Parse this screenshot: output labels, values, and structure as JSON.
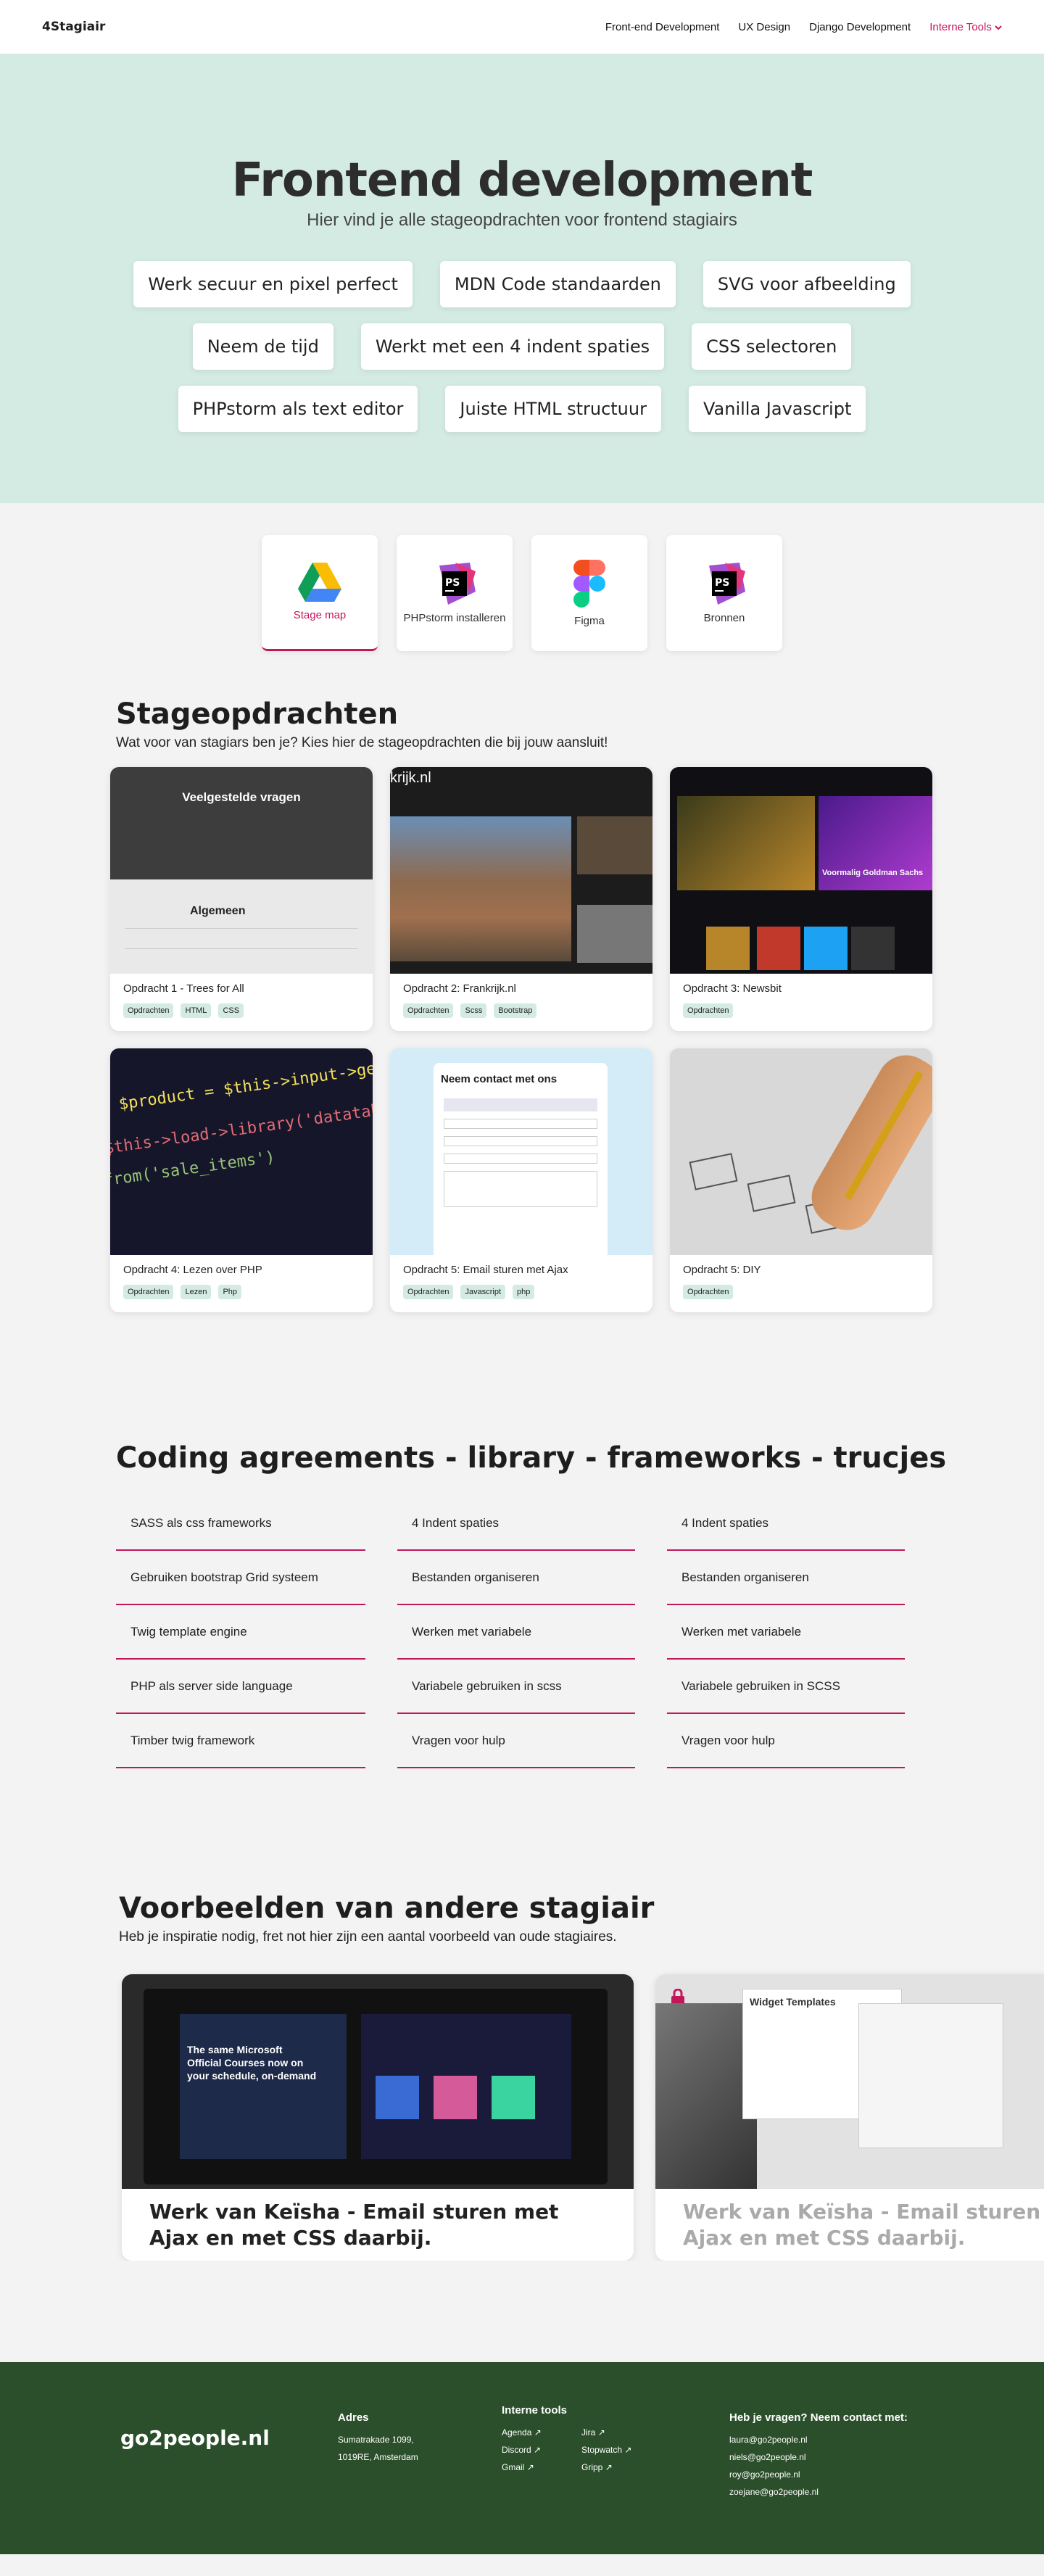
{
  "nav": {
    "logo": "4Stagiair",
    "links": [
      "Front-end Development",
      "UX Design",
      "Django Development"
    ],
    "dropdown": "Interne Tools"
  },
  "hero": {
    "title": "Frontend development",
    "subtitle": "Hier vind je alle stageopdrachten voor frontend stagiairs",
    "pills": [
      [
        "Werk secuur en pixel perfect",
        "MDN Code standaarden",
        "SVG voor afbeelding"
      ],
      [
        "Neem de tijd",
        "Werkt met een 4 indent spaties",
        "CSS selectoren"
      ],
      [
        "PHPstorm als text editor",
        "Juiste HTML structuur",
        "Vanilla Javascript"
      ]
    ]
  },
  "tools": [
    {
      "label": "Stage map",
      "icon": "google-drive-icon"
    },
    {
      "label": "PHPstorm installeren",
      "icon": "phpstorm-icon"
    },
    {
      "label": "Figma",
      "icon": "figma-icon"
    },
    {
      "label": "Bronnen",
      "icon": "phpstorm-icon"
    }
  ],
  "assignments": {
    "title": "Stageopdrachten",
    "subtitle": "Wat voor van stagiars ben je? Kies hier de stageopdrachten die bij jouw aansluit!",
    "cards": [
      {
        "title": "Opdracht 1  - Trees for All",
        "tags": [
          "Opdrachten",
          "HTML",
          "CSS"
        ],
        "img_text": "Veelgestelde vragen",
        "img_text2": "Algemeen"
      },
      {
        "title": "Opdracht 2: Frankrijk.nl",
        "tags": [
          "Opdrachten",
          "Scss",
          "Bootstrap"
        ],
        "img_text": "krijk.nl"
      },
      {
        "title": "Opdracht 3: Newsbit",
        "tags": [
          "Opdrachten"
        ],
        "img_text": "Voormalig Goldman Sachs"
      },
      {
        "title": "Opdracht 4: Lezen over PHP",
        "tags": [
          "Opdrachten",
          "Lezen",
          "Php"
        ],
        "img_text": "$product = $this->input->get('prod"
      },
      {
        "title": "Opdracht 5: Email sturen met Ajax",
        "tags": [
          "Opdrachten",
          "Javascript",
          "php"
        ],
        "img_text": "Neem contact met ons"
      },
      {
        "title": "Opdracht 5: DIY",
        "tags": [
          "Opdrachten"
        ]
      }
    ]
  },
  "agreements": {
    "title": "Coding agreements - library - frameworks - trucjes",
    "columns": [
      [
        "SASS als css frameworks",
        "Gebruiken bootstrap Grid systeem",
        "Twig template engine",
        "PHP als server side language",
        "Timber twig framework"
      ],
      [
        "4 Indent spaties",
        "Bestanden organiseren",
        "Werken met variabele",
        "Variabele gebruiken in scss",
        "Vragen voor hulp"
      ],
      [
        "4 Indent spaties",
        "Bestanden organiseren",
        "Werken met variabele",
        "Variabele gebruiken in SCSS",
        "Vragen voor hulp"
      ]
    ]
  },
  "examples": {
    "title": "Voorbeelden van andere stagiair",
    "subtitle": "Heb je inspiratie  nodig, fret not  hier zijn een aantal voorbeeld van oude stagiaires.",
    "slides": [
      {
        "title": "Werk van Keïsha - Email sturen met Ajax en met CSS daarbij.",
        "img_text": "The same Microsoft Official Courses now on your schedule, on-demand"
      },
      {
        "title": "Werk van Keïsha - Email sturen met Ajax en met CSS daarbij.",
        "img_text": "Widget Templates"
      }
    ]
  },
  "footer": {
    "logo": "go2people.nl",
    "address": {
      "title": "Adres",
      "lines": [
        "Sumatrakade 1099,",
        "1019RE, Amsterdam"
      ]
    },
    "tools": {
      "title": "Interne tools",
      "items": [
        "Agenda",
        "Jira",
        "Discord",
        "Stopwatch",
        "Gmail",
        "Gripp"
      ]
    },
    "contact": {
      "title": "Heb je vragen? Neem contact met:",
      "emails": [
        "laura@go2people.nl",
        "niels@go2people.nl",
        "roy@go2people.nl",
        "zoejane@go2people.nl"
      ]
    }
  },
  "colors": {
    "accent": "#c2185b",
    "hero_bg": "#d3ebe2",
    "footer_bg": "#2b4f2b"
  }
}
